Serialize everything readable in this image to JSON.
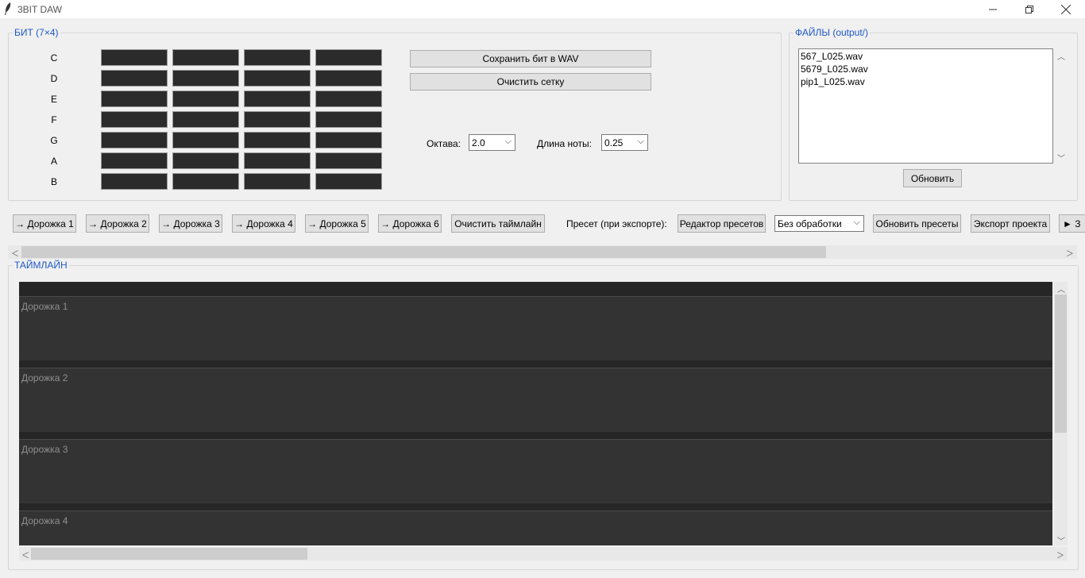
{
  "window": {
    "title": "3BIT DAW"
  },
  "beat": {
    "group_label": "БИТ (7×4)",
    "notes": [
      "C",
      "D",
      "E",
      "F",
      "G",
      "A",
      "B"
    ],
    "save_button": "Сохранить бит в WAV",
    "clear_button": "Очистить сетку",
    "octave_label": "Октава:",
    "octave_value": "2.0",
    "note_length_label": "Длина ноты:",
    "note_length_value": "0.25"
  },
  "files": {
    "group_label": "ФАЙЛЫ (output/)",
    "items": [
      "567_L025.wav",
      "5679_L025.wav",
      "pip1_L025.wav"
    ],
    "refresh_button": "Обновить"
  },
  "toolbar": {
    "track_buttons": [
      "→ Дорожка 1",
      "→ Дорожка 2",
      "→ Дорожка 3",
      "→ Дорожка 4",
      "→ Дорожка 5",
      "→ Дорожка 6"
    ],
    "clear_timeline": "Очистить таймлайн",
    "preset_label": "Пресет (при экспорте):",
    "preset_editor": "Редактор пресетов",
    "preset_value": "Без обработки",
    "refresh_presets": "Обновить пресеты",
    "export_project": "Экспорт проекта",
    "play_partial": "► З"
  },
  "timeline": {
    "group_label": "ТАЙМЛАЙН",
    "tracks": [
      "Дорожка 1",
      "Дорожка 2",
      "Дорожка 3",
      "Дорожка 4"
    ]
  }
}
